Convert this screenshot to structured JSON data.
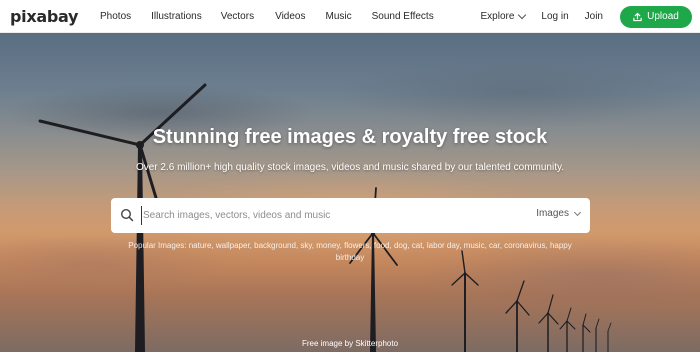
{
  "header": {
    "logo": "pixabay",
    "nav": [
      "Photos",
      "Illustrations",
      "Vectors",
      "Videos",
      "Music",
      "Sound Effects"
    ],
    "explore_label": "Explore",
    "login_label": "Log in",
    "join_label": "Join",
    "upload_label": "Upload"
  },
  "hero": {
    "title": "Stunning free images & royalty free stock",
    "subtitle": "Over 2.6 million+ high quality stock images, videos and music shared by our talented community.",
    "search": {
      "placeholder": "Search images, vectors, videos and music",
      "value": "",
      "type_label": "Images"
    },
    "popular_label": "Popular Images:",
    "popular_tags": [
      "nature",
      "wallpaper",
      "background",
      "sky",
      "money",
      "flowers",
      "food",
      "dog",
      "cat",
      "labor day",
      "music",
      "car",
      "coronavirus",
      "happy birthday"
    ],
    "credit": "Free image by Skitterphoto"
  },
  "colors": {
    "accent": "#1ea84a",
    "text": "#2a2a2a"
  },
  "icons": {
    "search": "search-icon",
    "upload": "upload-icon",
    "explore_chevron": "chevron-down-icon",
    "type_chevron": "chevron-down-icon"
  }
}
